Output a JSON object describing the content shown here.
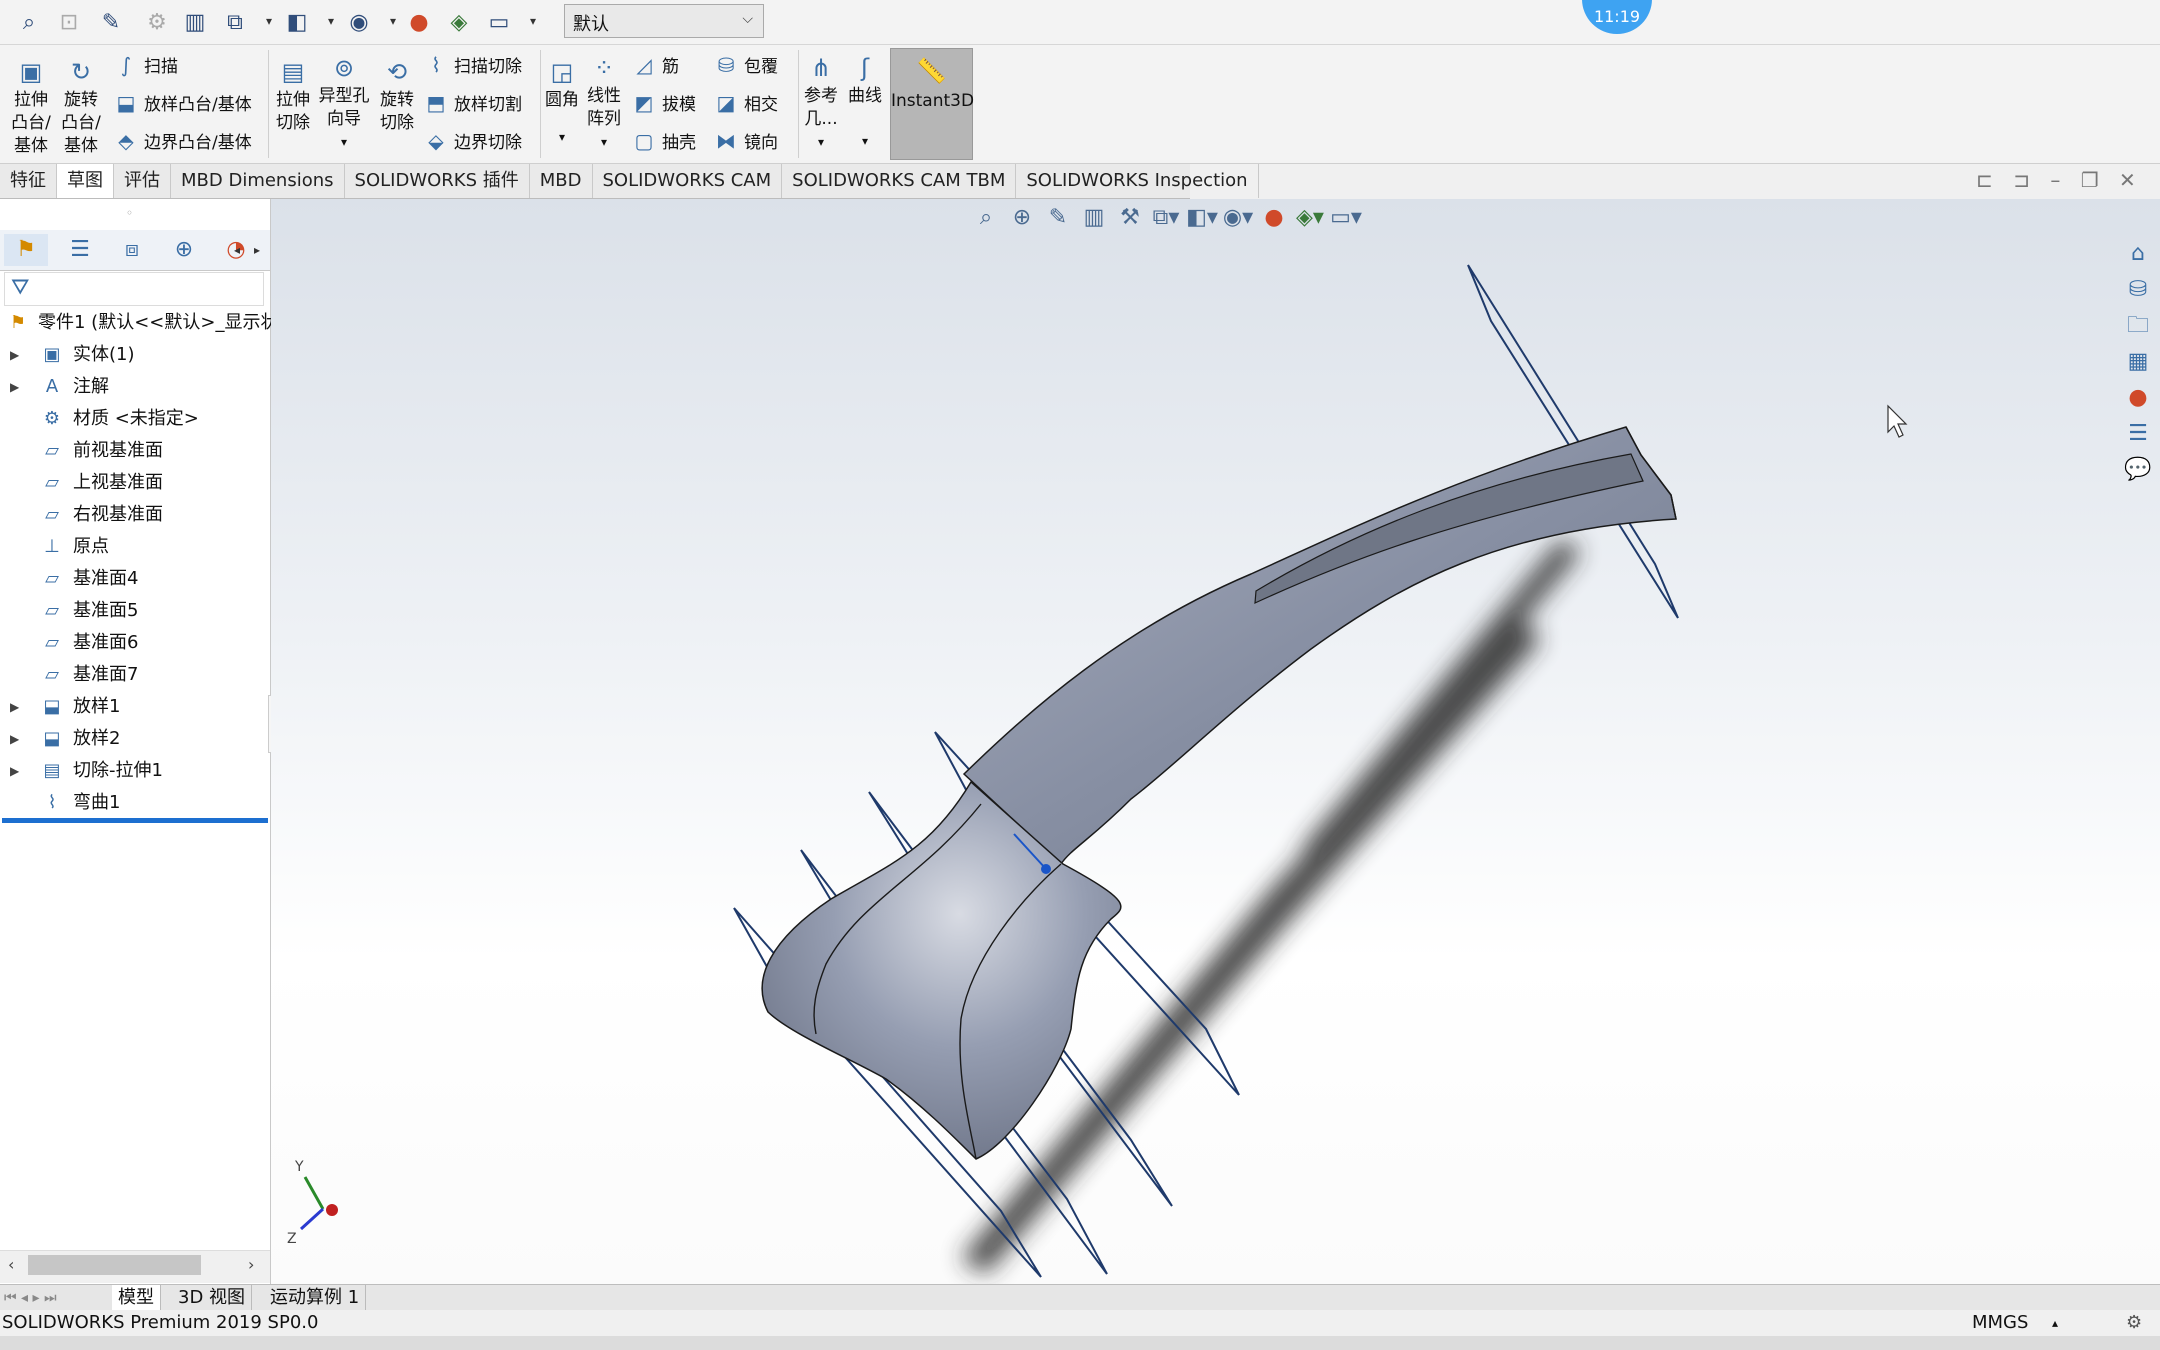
{
  "app": {
    "name": "SOLIDWORKS",
    "status_text": "SOLIDWORKS Premium 2019 SP0.0",
    "units": "MMGS",
    "units_arrow": "▴"
  },
  "quickbar": {
    "config_value": "默认",
    "clock_badge": "11:19"
  },
  "ribbon": {
    "extrude_boss": "拉伸\n凸台/\n基体",
    "revolve_boss": "旋转\n凸台/\n基体",
    "sweep": "扫描",
    "loft_boss": "放样凸台/基体",
    "boundary_boss": "边界凸台/基体",
    "extrude_cut": "拉伸\n切除",
    "hole_wizard": "异型孔\n向导",
    "revolve_cut": "旋转\n切除",
    "sweep_cut": "扫描切除",
    "loft_cut": "放样切割",
    "boundary_cut": "边界切除",
    "fillet": "圆角",
    "linear_pattern": "线性\n阵列",
    "rib": "筋",
    "draft": "拔模",
    "shell": "抽壳",
    "wrap": "包覆",
    "intersect": "相交",
    "mirror": "镜向",
    "reference_geometry": "参考\n几...",
    "curves": "曲线",
    "instant3d": "Instant3D"
  },
  "tabs": [
    "特征",
    "草图",
    "评估",
    "MBD Dimensions",
    "SOLIDWORKS 插件",
    "MBD",
    "SOLIDWORKS CAM",
    "SOLIDWORKS CAM TBM",
    "SOLIDWORKS Inspection"
  ],
  "feature_tree": {
    "root": "零件1  (默认<<默认>_显示状",
    "items": [
      {
        "label": "实体(1)",
        "expandable": true,
        "icon": "solid-bodies-icon"
      },
      {
        "label": "注解",
        "expandable": true,
        "icon": "annotations-icon"
      },
      {
        "label": "材质 <未指定>",
        "expandable": false,
        "icon": "material-icon"
      },
      {
        "label": "前视基准面",
        "expandable": false,
        "icon": "plane-icon"
      },
      {
        "label": "上视基准面",
        "expandable": false,
        "icon": "plane-icon"
      },
      {
        "label": "右视基准面",
        "expandable": false,
        "icon": "plane-icon"
      },
      {
        "label": "原点",
        "expandable": false,
        "icon": "origin-icon"
      },
      {
        "label": "基准面4",
        "expandable": false,
        "icon": "plane-icon"
      },
      {
        "label": "基准面5",
        "expandable": false,
        "icon": "plane-icon"
      },
      {
        "label": "基准面6",
        "expandable": false,
        "icon": "plane-icon"
      },
      {
        "label": "基准面7",
        "expandable": false,
        "icon": "plane-icon"
      },
      {
        "label": "放样1",
        "expandable": true,
        "icon": "loft-icon"
      },
      {
        "label": "放样2",
        "expandable": true,
        "icon": "loft-icon"
      },
      {
        "label": "切除-拉伸1",
        "expandable": true,
        "icon": "cut-extrude-icon"
      },
      {
        "label": "弯曲1",
        "expandable": false,
        "icon": "flex-icon"
      }
    ]
  },
  "triad": {
    "y": "Y",
    "z": "Z"
  },
  "bottom_tabs": [
    "模型",
    "3D 视图",
    "运动算例 1"
  ],
  "colors": {
    "accent": "#1d6fd0",
    "plane_lines": "#1f3a6b",
    "model_body": "#8a93a8",
    "instant3d_active": "#b6b6b6"
  }
}
